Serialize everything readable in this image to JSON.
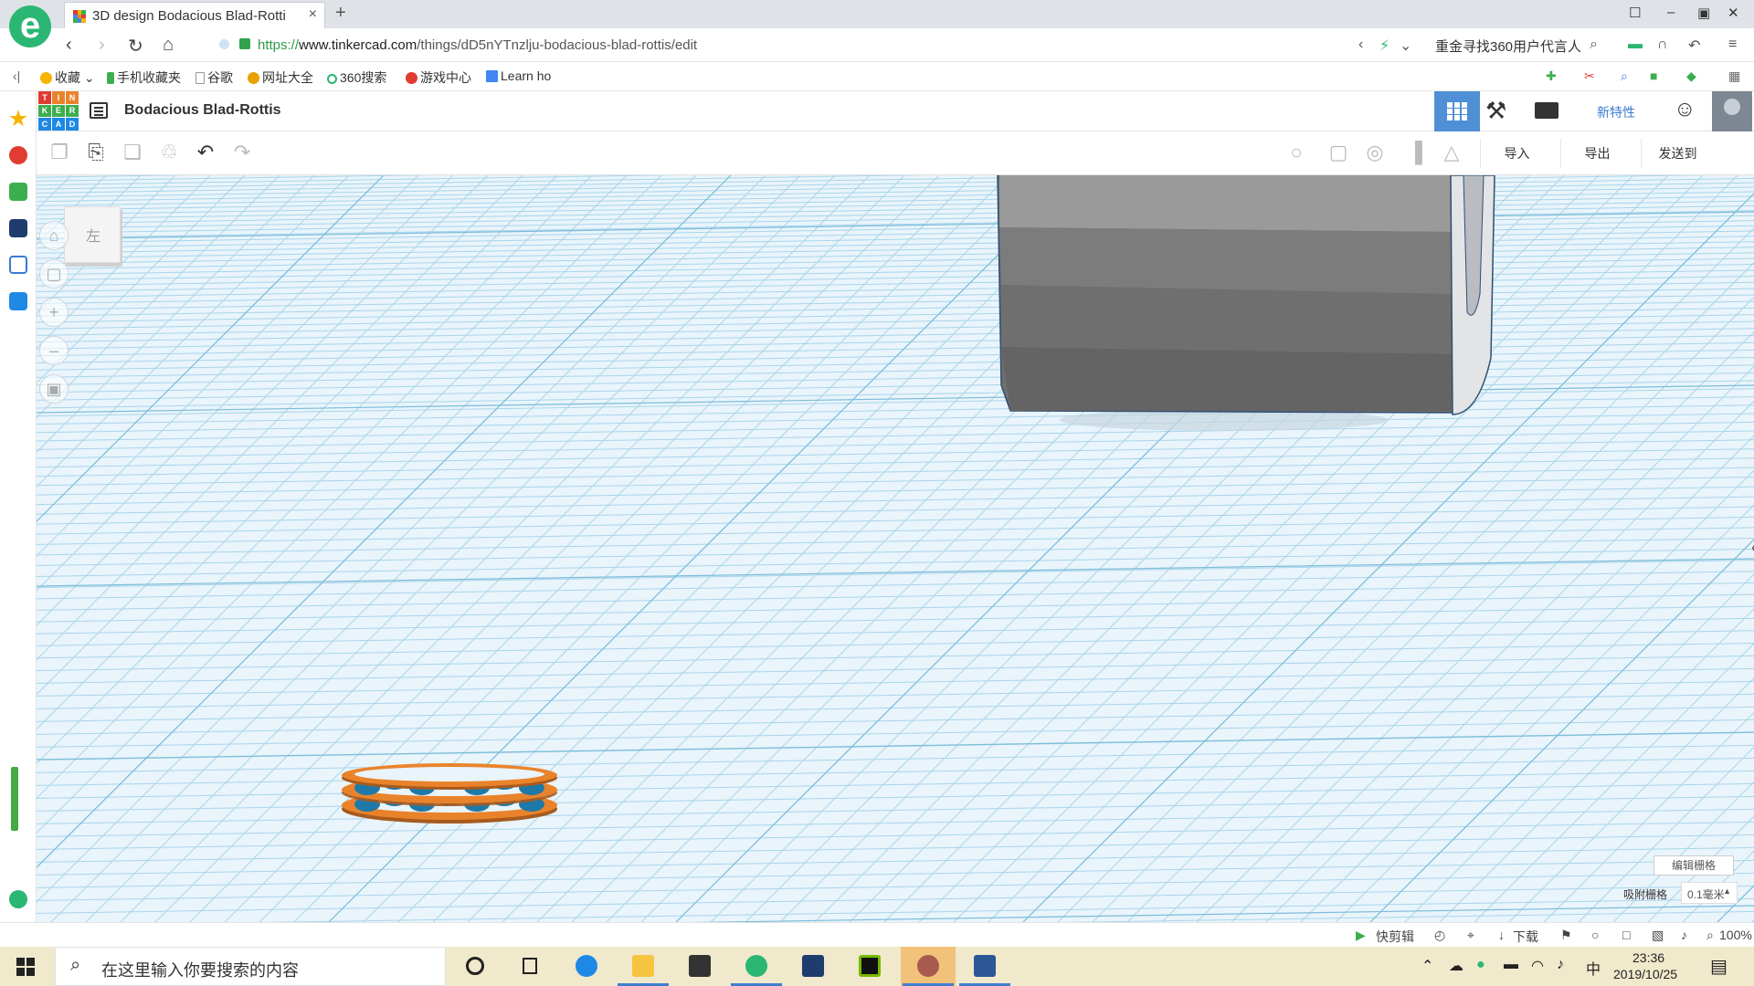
{
  "browser": {
    "tab_title": "3D design Bodacious Blad-Rotti",
    "tab_close": "×",
    "new_tab": "+",
    "url_scheme": "https://",
    "url_host": "www.tinkercad.com",
    "url_path": "/things/dD5nYTnzlju-bodacious-blad-rottis/edit",
    "search_promo": "重金寻找360用户代言人",
    "window_controls": [
      "☐",
      "–",
      "▣",
      "✕"
    ]
  },
  "bookmarks": [
    {
      "label": "收藏",
      "color": "#f5b400"
    },
    {
      "label": "手机收藏夹",
      "color": "#3cae4e"
    },
    {
      "label": "谷歌",
      "color": "#999999"
    },
    {
      "label": "网址大全",
      "color": "#e9a100"
    },
    {
      "label": "360搜索",
      "color": "#2bb673"
    },
    {
      "label": "游戏中心",
      "color": "#e03c31"
    },
    {
      "label": "Learn ho",
      "color": "#4285f4"
    }
  ],
  "tinkercad": {
    "logo_letters": [
      "TIN",
      "KER",
      "CAD"
    ],
    "design_title": "Bodacious Blad-Rottis",
    "new_feature": "新特性",
    "import_label": "导入",
    "export_label": "导出",
    "send_label": "发送到",
    "viewcube_label": "左",
    "edit_grid_label": "编辑栅格",
    "snap_grid_label": "吸附栅格",
    "snap_grid_value": "0.1毫米",
    "colors": {
      "accent": "#4f8fd6",
      "grid_line": "#9fd0e6",
      "cylinder": "#7a7a7a",
      "ring": "#e9832b",
      "ball": "#1f79a8"
    }
  },
  "statusbar": {
    "quick_cut": "快剪辑",
    "download": "下载",
    "zoom": "100%"
  },
  "taskbar": {
    "search_placeholder": "在这里输入你要搜索的内容",
    "time": "23:36",
    "date": "2019/10/25",
    "ime": "中"
  }
}
